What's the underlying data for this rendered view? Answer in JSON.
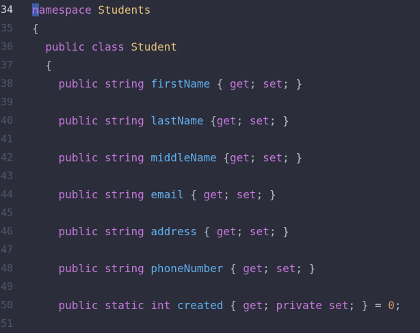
{
  "editor": {
    "active_line": "34",
    "lines": [
      {
        "num": "34",
        "tokens": [
          {
            "t": "n",
            "c": "cursor-sel"
          },
          {
            "t": "amespace",
            "c": "kw"
          },
          {
            "t": " ",
            "c": "pn"
          },
          {
            "t": "Students",
            "c": "cls"
          }
        ]
      },
      {
        "num": "35",
        "tokens": [
          {
            "t": "{",
            "c": "pn"
          }
        ]
      },
      {
        "num": "36",
        "tokens": [
          {
            "t": "  ",
            "c": "pn"
          },
          {
            "t": "public",
            "c": "kw"
          },
          {
            "t": " ",
            "c": "pn"
          },
          {
            "t": "class",
            "c": "kw"
          },
          {
            "t": " ",
            "c": "pn"
          },
          {
            "t": "Student",
            "c": "cls"
          }
        ]
      },
      {
        "num": "37",
        "tokens": [
          {
            "t": "  {",
            "c": "pn"
          }
        ]
      },
      {
        "num": "38",
        "tokens": [
          {
            "t": "    ",
            "c": "pn"
          },
          {
            "t": "public",
            "c": "kw"
          },
          {
            "t": " ",
            "c": "pn"
          },
          {
            "t": "string",
            "c": "kw"
          },
          {
            "t": " ",
            "c": "pn"
          },
          {
            "t": "firstName",
            "c": "id"
          },
          {
            "t": " { ",
            "c": "pn"
          },
          {
            "t": "get",
            "c": "kw"
          },
          {
            "t": "; ",
            "c": "pn"
          },
          {
            "t": "set",
            "c": "kw"
          },
          {
            "t": "; }",
            "c": "pn"
          }
        ]
      },
      {
        "num": "39",
        "tokens": []
      },
      {
        "num": "40",
        "tokens": [
          {
            "t": "    ",
            "c": "pn"
          },
          {
            "t": "public",
            "c": "kw"
          },
          {
            "t": " ",
            "c": "pn"
          },
          {
            "t": "string",
            "c": "kw"
          },
          {
            "t": " ",
            "c": "pn"
          },
          {
            "t": "lastName",
            "c": "id"
          },
          {
            "t": " {",
            "c": "pn"
          },
          {
            "t": "get",
            "c": "kw"
          },
          {
            "t": "; ",
            "c": "pn"
          },
          {
            "t": "set",
            "c": "kw"
          },
          {
            "t": "; }",
            "c": "pn"
          }
        ]
      },
      {
        "num": "41",
        "tokens": []
      },
      {
        "num": "42",
        "tokens": [
          {
            "t": "    ",
            "c": "pn"
          },
          {
            "t": "public",
            "c": "kw"
          },
          {
            "t": " ",
            "c": "pn"
          },
          {
            "t": "string",
            "c": "kw"
          },
          {
            "t": " ",
            "c": "pn"
          },
          {
            "t": "middleName",
            "c": "id"
          },
          {
            "t": " {",
            "c": "pn"
          },
          {
            "t": "get",
            "c": "kw"
          },
          {
            "t": "; ",
            "c": "pn"
          },
          {
            "t": "set",
            "c": "kw"
          },
          {
            "t": "; }",
            "c": "pn"
          }
        ]
      },
      {
        "num": "43",
        "tokens": []
      },
      {
        "num": "44",
        "tokens": [
          {
            "t": "    ",
            "c": "pn"
          },
          {
            "t": "public",
            "c": "kw"
          },
          {
            "t": " ",
            "c": "pn"
          },
          {
            "t": "string",
            "c": "kw"
          },
          {
            "t": " ",
            "c": "pn"
          },
          {
            "t": "email",
            "c": "id"
          },
          {
            "t": " { ",
            "c": "pn"
          },
          {
            "t": "get",
            "c": "kw"
          },
          {
            "t": "; ",
            "c": "pn"
          },
          {
            "t": "set",
            "c": "kw"
          },
          {
            "t": "; }",
            "c": "pn"
          }
        ]
      },
      {
        "num": "45",
        "tokens": []
      },
      {
        "num": "46",
        "tokens": [
          {
            "t": "    ",
            "c": "pn"
          },
          {
            "t": "public",
            "c": "kw"
          },
          {
            "t": " ",
            "c": "pn"
          },
          {
            "t": "string",
            "c": "kw"
          },
          {
            "t": " ",
            "c": "pn"
          },
          {
            "t": "address",
            "c": "id"
          },
          {
            "t": " { ",
            "c": "pn"
          },
          {
            "t": "get",
            "c": "kw"
          },
          {
            "t": "; ",
            "c": "pn"
          },
          {
            "t": "set",
            "c": "kw"
          },
          {
            "t": "; }",
            "c": "pn"
          }
        ]
      },
      {
        "num": "47",
        "tokens": []
      },
      {
        "num": "48",
        "tokens": [
          {
            "t": "    ",
            "c": "pn"
          },
          {
            "t": "public",
            "c": "kw"
          },
          {
            "t": " ",
            "c": "pn"
          },
          {
            "t": "string",
            "c": "kw"
          },
          {
            "t": " ",
            "c": "pn"
          },
          {
            "t": "phoneNumber",
            "c": "id"
          },
          {
            "t": " { ",
            "c": "pn"
          },
          {
            "t": "get",
            "c": "kw"
          },
          {
            "t": "; ",
            "c": "pn"
          },
          {
            "t": "set",
            "c": "kw"
          },
          {
            "t": "; }",
            "c": "pn"
          }
        ]
      },
      {
        "num": "49",
        "tokens": []
      },
      {
        "num": "50",
        "tokens": [
          {
            "t": "    ",
            "c": "pn"
          },
          {
            "t": "public",
            "c": "kw"
          },
          {
            "t": " ",
            "c": "pn"
          },
          {
            "t": "static",
            "c": "kw"
          },
          {
            "t": " ",
            "c": "pn"
          },
          {
            "t": "int",
            "c": "kw"
          },
          {
            "t": " ",
            "c": "pn"
          },
          {
            "t": "created",
            "c": "id"
          },
          {
            "t": " { ",
            "c": "pn"
          },
          {
            "t": "get",
            "c": "kw"
          },
          {
            "t": "; ",
            "c": "pn"
          },
          {
            "t": "private",
            "c": "kw"
          },
          {
            "t": " ",
            "c": "pn"
          },
          {
            "t": "set",
            "c": "kw"
          },
          {
            "t": "; } = ",
            "c": "pn"
          },
          {
            "t": "0",
            "c": "num"
          },
          {
            "t": ";",
            "c": "pn"
          }
        ]
      },
      {
        "num": "51",
        "tokens": []
      }
    ]
  },
  "colors": {
    "background": "#2b2e3a",
    "keyword": "#c678dd",
    "type": "#e5c07b",
    "identifier": "#61afef",
    "number": "#d19a66",
    "selection": "#3f5ca8"
  }
}
